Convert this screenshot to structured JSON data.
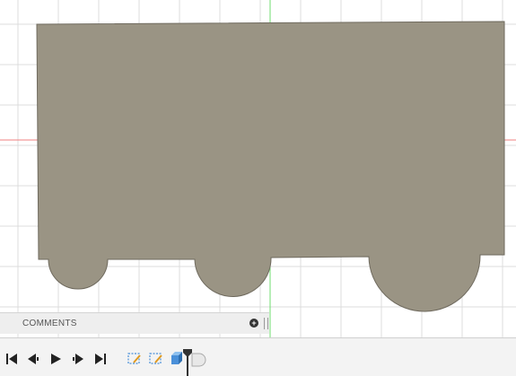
{
  "viewport": {
    "grid_color": "#dcdcdc",
    "axis_y_color": "#6fdc6f",
    "axis_x_color": "#f08080",
    "sketch_fill": "#9a9484",
    "sketch_stroke": "#6f6a5e"
  },
  "comments": {
    "label": "COMMENTS",
    "add_icon": "plus-circle-icon",
    "handle_icon": "panel-resize-handle-icon"
  },
  "timeline": {
    "controls": [
      {
        "icon": "skip-to-start-icon"
      },
      {
        "icon": "step-back-icon"
      },
      {
        "icon": "play-icon"
      },
      {
        "icon": "step-forward-icon"
      },
      {
        "icon": "skip-to-end-icon"
      }
    ],
    "features": [
      {
        "icon": "sketch-feature-icon"
      },
      {
        "icon": "sketch-feature-icon"
      },
      {
        "icon": "extrude-feature-icon"
      },
      {
        "icon": "fillet-feature-icon"
      }
    ],
    "accent": "#4a90d9"
  }
}
